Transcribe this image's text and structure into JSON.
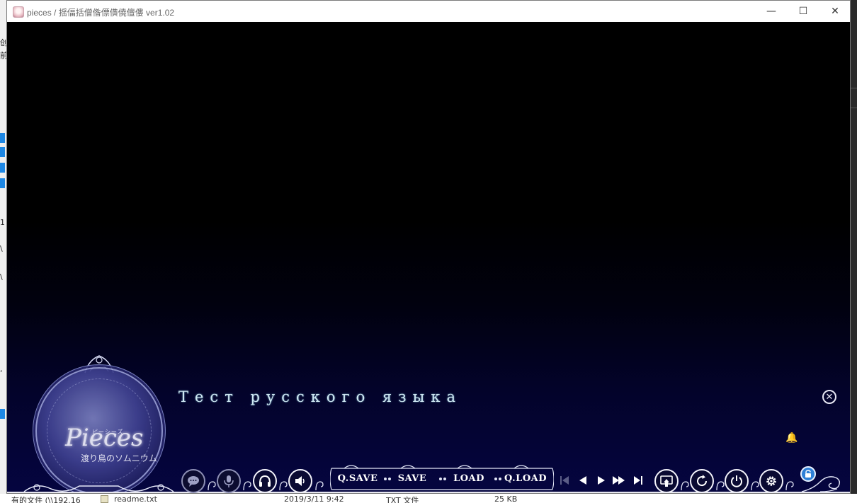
{
  "window": {
    "title": "pieces / 揺偪括僧偺僄僙僥儃僂 ver1.02",
    "minimize_glyph": "—",
    "maximize_glyph": "☐",
    "close_glyph": "✕"
  },
  "game": {
    "logo": {
      "title": "Pieces",
      "kana": "ピーシーズ",
      "subtitle": "渡り鳥のソムニウム"
    },
    "message_text": "Тест русского языка",
    "message_close_glyph": "✕",
    "bell_glyph": "🔔",
    "quick_menu": {
      "text_buttons": [
        "Q.SAVE",
        "SAVE",
        "LOAD",
        "Q.LOAD"
      ],
      "icon_buttons_left": [
        "speech-bubble-icon",
        "microphone-icon",
        "headphones-icon",
        "speaker-icon"
      ],
      "nav_buttons": [
        "skip-to-start-icon",
        "back-icon",
        "play-icon",
        "fast-forward-icon",
        "skip-to-end-icon"
      ],
      "icon_buttons_right": [
        "hide-window-icon",
        "replay-icon",
        "power-icon",
        "gear-icon",
        "lock-icon"
      ]
    }
  },
  "background": {
    "left_fragments": [
      "创",
      "前",
      "1",
      "\\",
      "\\",
      ","
    ],
    "taskbar_row": {
      "path": "有的文件 (\\\\192.16",
      "filename": "readme.txt",
      "date": "2019/3/11 9:42",
      "type": "TXT 文件",
      "size": "25 KB"
    }
  },
  "colors": {
    "game_bg_top": "#000000",
    "game_bg_bottom": "#050540",
    "message_text": "#cfe7f2",
    "lock_accent": "#2d7fd6"
  }
}
